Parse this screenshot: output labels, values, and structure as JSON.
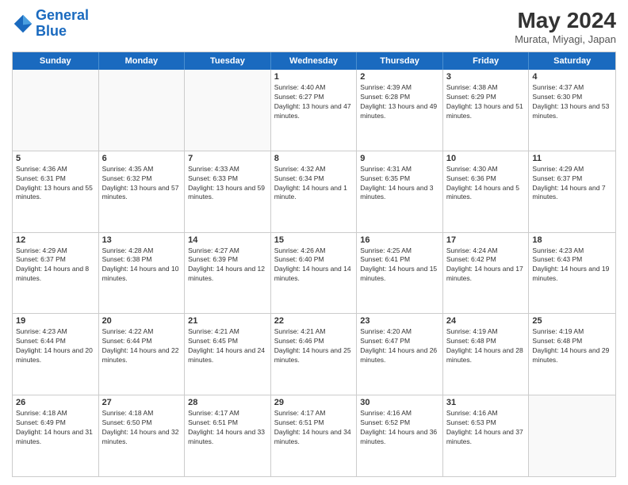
{
  "header": {
    "logo_line1": "General",
    "logo_line2": "Blue",
    "month_year": "May 2024",
    "location": "Murata, Miyagi, Japan"
  },
  "weekdays": [
    "Sunday",
    "Monday",
    "Tuesday",
    "Wednesday",
    "Thursday",
    "Friday",
    "Saturday"
  ],
  "weeks": [
    [
      {
        "day": "",
        "info": ""
      },
      {
        "day": "",
        "info": ""
      },
      {
        "day": "",
        "info": ""
      },
      {
        "day": "1",
        "info": "Sunrise: 4:40 AM\nSunset: 6:27 PM\nDaylight: 13 hours and 47 minutes."
      },
      {
        "day": "2",
        "info": "Sunrise: 4:39 AM\nSunset: 6:28 PM\nDaylight: 13 hours and 49 minutes."
      },
      {
        "day": "3",
        "info": "Sunrise: 4:38 AM\nSunset: 6:29 PM\nDaylight: 13 hours and 51 minutes."
      },
      {
        "day": "4",
        "info": "Sunrise: 4:37 AM\nSunset: 6:30 PM\nDaylight: 13 hours and 53 minutes."
      }
    ],
    [
      {
        "day": "5",
        "info": "Sunrise: 4:36 AM\nSunset: 6:31 PM\nDaylight: 13 hours and 55 minutes."
      },
      {
        "day": "6",
        "info": "Sunrise: 4:35 AM\nSunset: 6:32 PM\nDaylight: 13 hours and 57 minutes."
      },
      {
        "day": "7",
        "info": "Sunrise: 4:33 AM\nSunset: 6:33 PM\nDaylight: 13 hours and 59 minutes."
      },
      {
        "day": "8",
        "info": "Sunrise: 4:32 AM\nSunset: 6:34 PM\nDaylight: 14 hours and 1 minute."
      },
      {
        "day": "9",
        "info": "Sunrise: 4:31 AM\nSunset: 6:35 PM\nDaylight: 14 hours and 3 minutes."
      },
      {
        "day": "10",
        "info": "Sunrise: 4:30 AM\nSunset: 6:36 PM\nDaylight: 14 hours and 5 minutes."
      },
      {
        "day": "11",
        "info": "Sunrise: 4:29 AM\nSunset: 6:37 PM\nDaylight: 14 hours and 7 minutes."
      }
    ],
    [
      {
        "day": "12",
        "info": "Sunrise: 4:29 AM\nSunset: 6:37 PM\nDaylight: 14 hours and 8 minutes."
      },
      {
        "day": "13",
        "info": "Sunrise: 4:28 AM\nSunset: 6:38 PM\nDaylight: 14 hours and 10 minutes."
      },
      {
        "day": "14",
        "info": "Sunrise: 4:27 AM\nSunset: 6:39 PM\nDaylight: 14 hours and 12 minutes."
      },
      {
        "day": "15",
        "info": "Sunrise: 4:26 AM\nSunset: 6:40 PM\nDaylight: 14 hours and 14 minutes."
      },
      {
        "day": "16",
        "info": "Sunrise: 4:25 AM\nSunset: 6:41 PM\nDaylight: 14 hours and 15 minutes."
      },
      {
        "day": "17",
        "info": "Sunrise: 4:24 AM\nSunset: 6:42 PM\nDaylight: 14 hours and 17 minutes."
      },
      {
        "day": "18",
        "info": "Sunrise: 4:23 AM\nSunset: 6:43 PM\nDaylight: 14 hours and 19 minutes."
      }
    ],
    [
      {
        "day": "19",
        "info": "Sunrise: 4:23 AM\nSunset: 6:44 PM\nDaylight: 14 hours and 20 minutes."
      },
      {
        "day": "20",
        "info": "Sunrise: 4:22 AM\nSunset: 6:44 PM\nDaylight: 14 hours and 22 minutes."
      },
      {
        "day": "21",
        "info": "Sunrise: 4:21 AM\nSunset: 6:45 PM\nDaylight: 14 hours and 24 minutes."
      },
      {
        "day": "22",
        "info": "Sunrise: 4:21 AM\nSunset: 6:46 PM\nDaylight: 14 hours and 25 minutes."
      },
      {
        "day": "23",
        "info": "Sunrise: 4:20 AM\nSunset: 6:47 PM\nDaylight: 14 hours and 26 minutes."
      },
      {
        "day": "24",
        "info": "Sunrise: 4:19 AM\nSunset: 6:48 PM\nDaylight: 14 hours and 28 minutes."
      },
      {
        "day": "25",
        "info": "Sunrise: 4:19 AM\nSunset: 6:48 PM\nDaylight: 14 hours and 29 minutes."
      }
    ],
    [
      {
        "day": "26",
        "info": "Sunrise: 4:18 AM\nSunset: 6:49 PM\nDaylight: 14 hours and 31 minutes."
      },
      {
        "day": "27",
        "info": "Sunrise: 4:18 AM\nSunset: 6:50 PM\nDaylight: 14 hours and 32 minutes."
      },
      {
        "day": "28",
        "info": "Sunrise: 4:17 AM\nSunset: 6:51 PM\nDaylight: 14 hours and 33 minutes."
      },
      {
        "day": "29",
        "info": "Sunrise: 4:17 AM\nSunset: 6:51 PM\nDaylight: 14 hours and 34 minutes."
      },
      {
        "day": "30",
        "info": "Sunrise: 4:16 AM\nSunset: 6:52 PM\nDaylight: 14 hours and 36 minutes."
      },
      {
        "day": "31",
        "info": "Sunrise: 4:16 AM\nSunset: 6:53 PM\nDaylight: 14 hours and 37 minutes."
      },
      {
        "day": "",
        "info": ""
      }
    ]
  ]
}
